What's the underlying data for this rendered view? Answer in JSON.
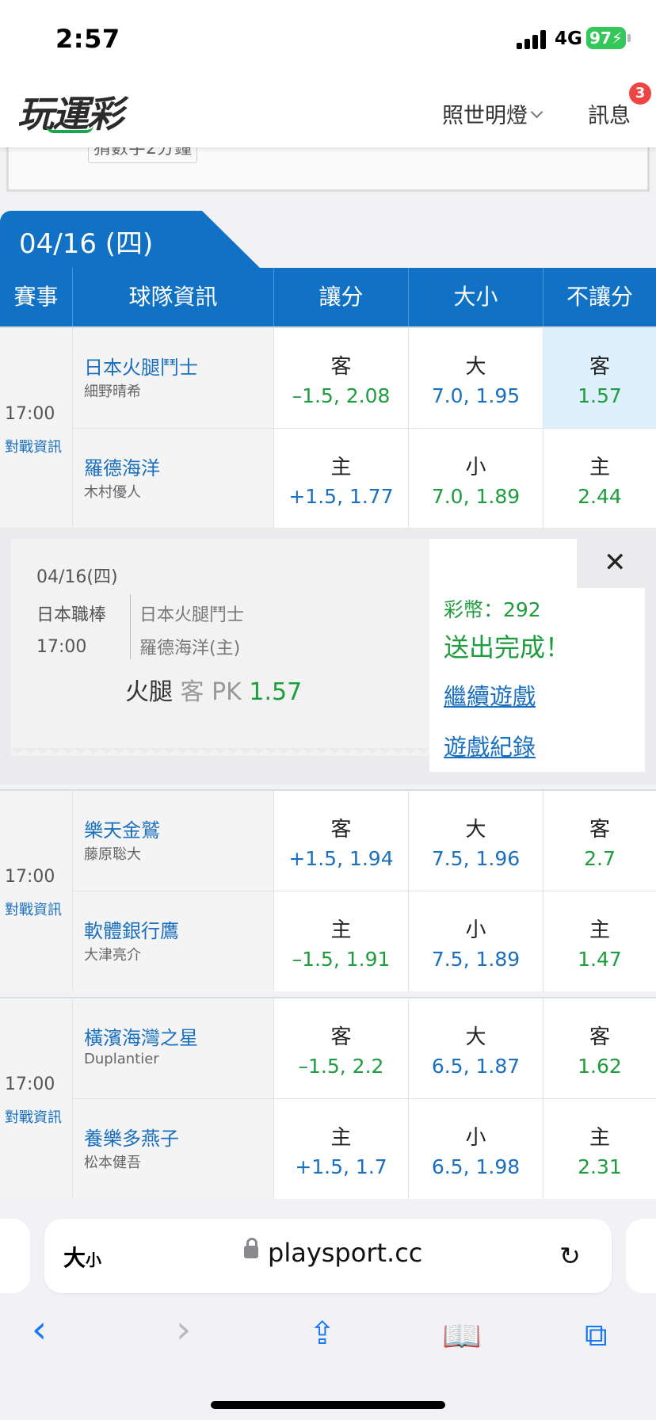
{
  "status": {
    "time": "2:57",
    "network": "4G",
    "battery": "97"
  },
  "header": {
    "logo": "玩運彩",
    "user": "照世明燈",
    "messages_label": "訊息",
    "messages_badge": "3"
  },
  "notice": {
    "text": "猜數字2分鐘"
  },
  "date_tab": "04/16 (四)",
  "columns": [
    "賽事",
    "球隊資訊",
    "讓分",
    "大小",
    "不讓分"
  ],
  "matches": [
    {
      "time": "17:00",
      "info_link": "對戰資訊",
      "away": {
        "team": "日本火腿鬥士",
        "pitcher": "細野晴希",
        "spread_side": "客",
        "spread": "–1.5, 2.08",
        "total_side": "大",
        "total": "7.0, 1.95",
        "ml_side": "客",
        "ml": "1.57"
      },
      "home": {
        "team": "羅德海洋",
        "pitcher": "木村優人",
        "spread_side": "主",
        "spread": "+1.5, 1.77",
        "total_side": "小",
        "total": "7.0, 1.89",
        "ml_side": "主",
        "ml": "2.44"
      }
    },
    {
      "time": "17:00",
      "info_link": "對戰資訊",
      "away": {
        "team": "樂天金鷲",
        "pitcher": "藤原聡大",
        "spread_side": "客",
        "spread": "+1.5, 1.94",
        "total_side": "大",
        "total": "7.5, 1.96",
        "ml_side": "客",
        "ml": "2.7"
      },
      "home": {
        "team": "軟體銀行鷹",
        "pitcher": "大津亮介",
        "spread_side": "主",
        "spread": "–1.5, 1.91",
        "total_side": "小",
        "total": "7.5, 1.89",
        "ml_side": "主",
        "ml": "1.47"
      }
    },
    {
      "time": "17:00",
      "info_link": "對戰資訊",
      "away": {
        "team": "橫濱海灣之星",
        "pitcher": "Duplantier",
        "spread_side": "客",
        "spread": "–1.5, 2.2",
        "total_side": "大",
        "total": "6.5, 1.87",
        "ml_side": "客",
        "ml": "1.62"
      },
      "home": {
        "team": "養樂多燕子",
        "pitcher": "松本健吾",
        "spread_side": "主",
        "spread": "+1.5, 1.7",
        "total_side": "小",
        "total": "6.5, 1.98",
        "ml_side": "主",
        "ml": "2.31"
      }
    }
  ],
  "confirmation": {
    "date": "04/16(四)",
    "league": "日本職棒",
    "time": "17:00",
    "away": "日本火腿鬥士",
    "home": "羅德海洋(主)",
    "pick_team": "火腿",
    "pick_side": "客",
    "pick_type": "PK",
    "pick_odds": "1.57",
    "coins": "彩幣：292",
    "status": "送出完成！",
    "continue_link": "繼續遊戲",
    "history_link": "遊戲紀錄"
  },
  "browser": {
    "text_size": "大",
    "text_size_small": "小",
    "url": "playsport.cc"
  }
}
